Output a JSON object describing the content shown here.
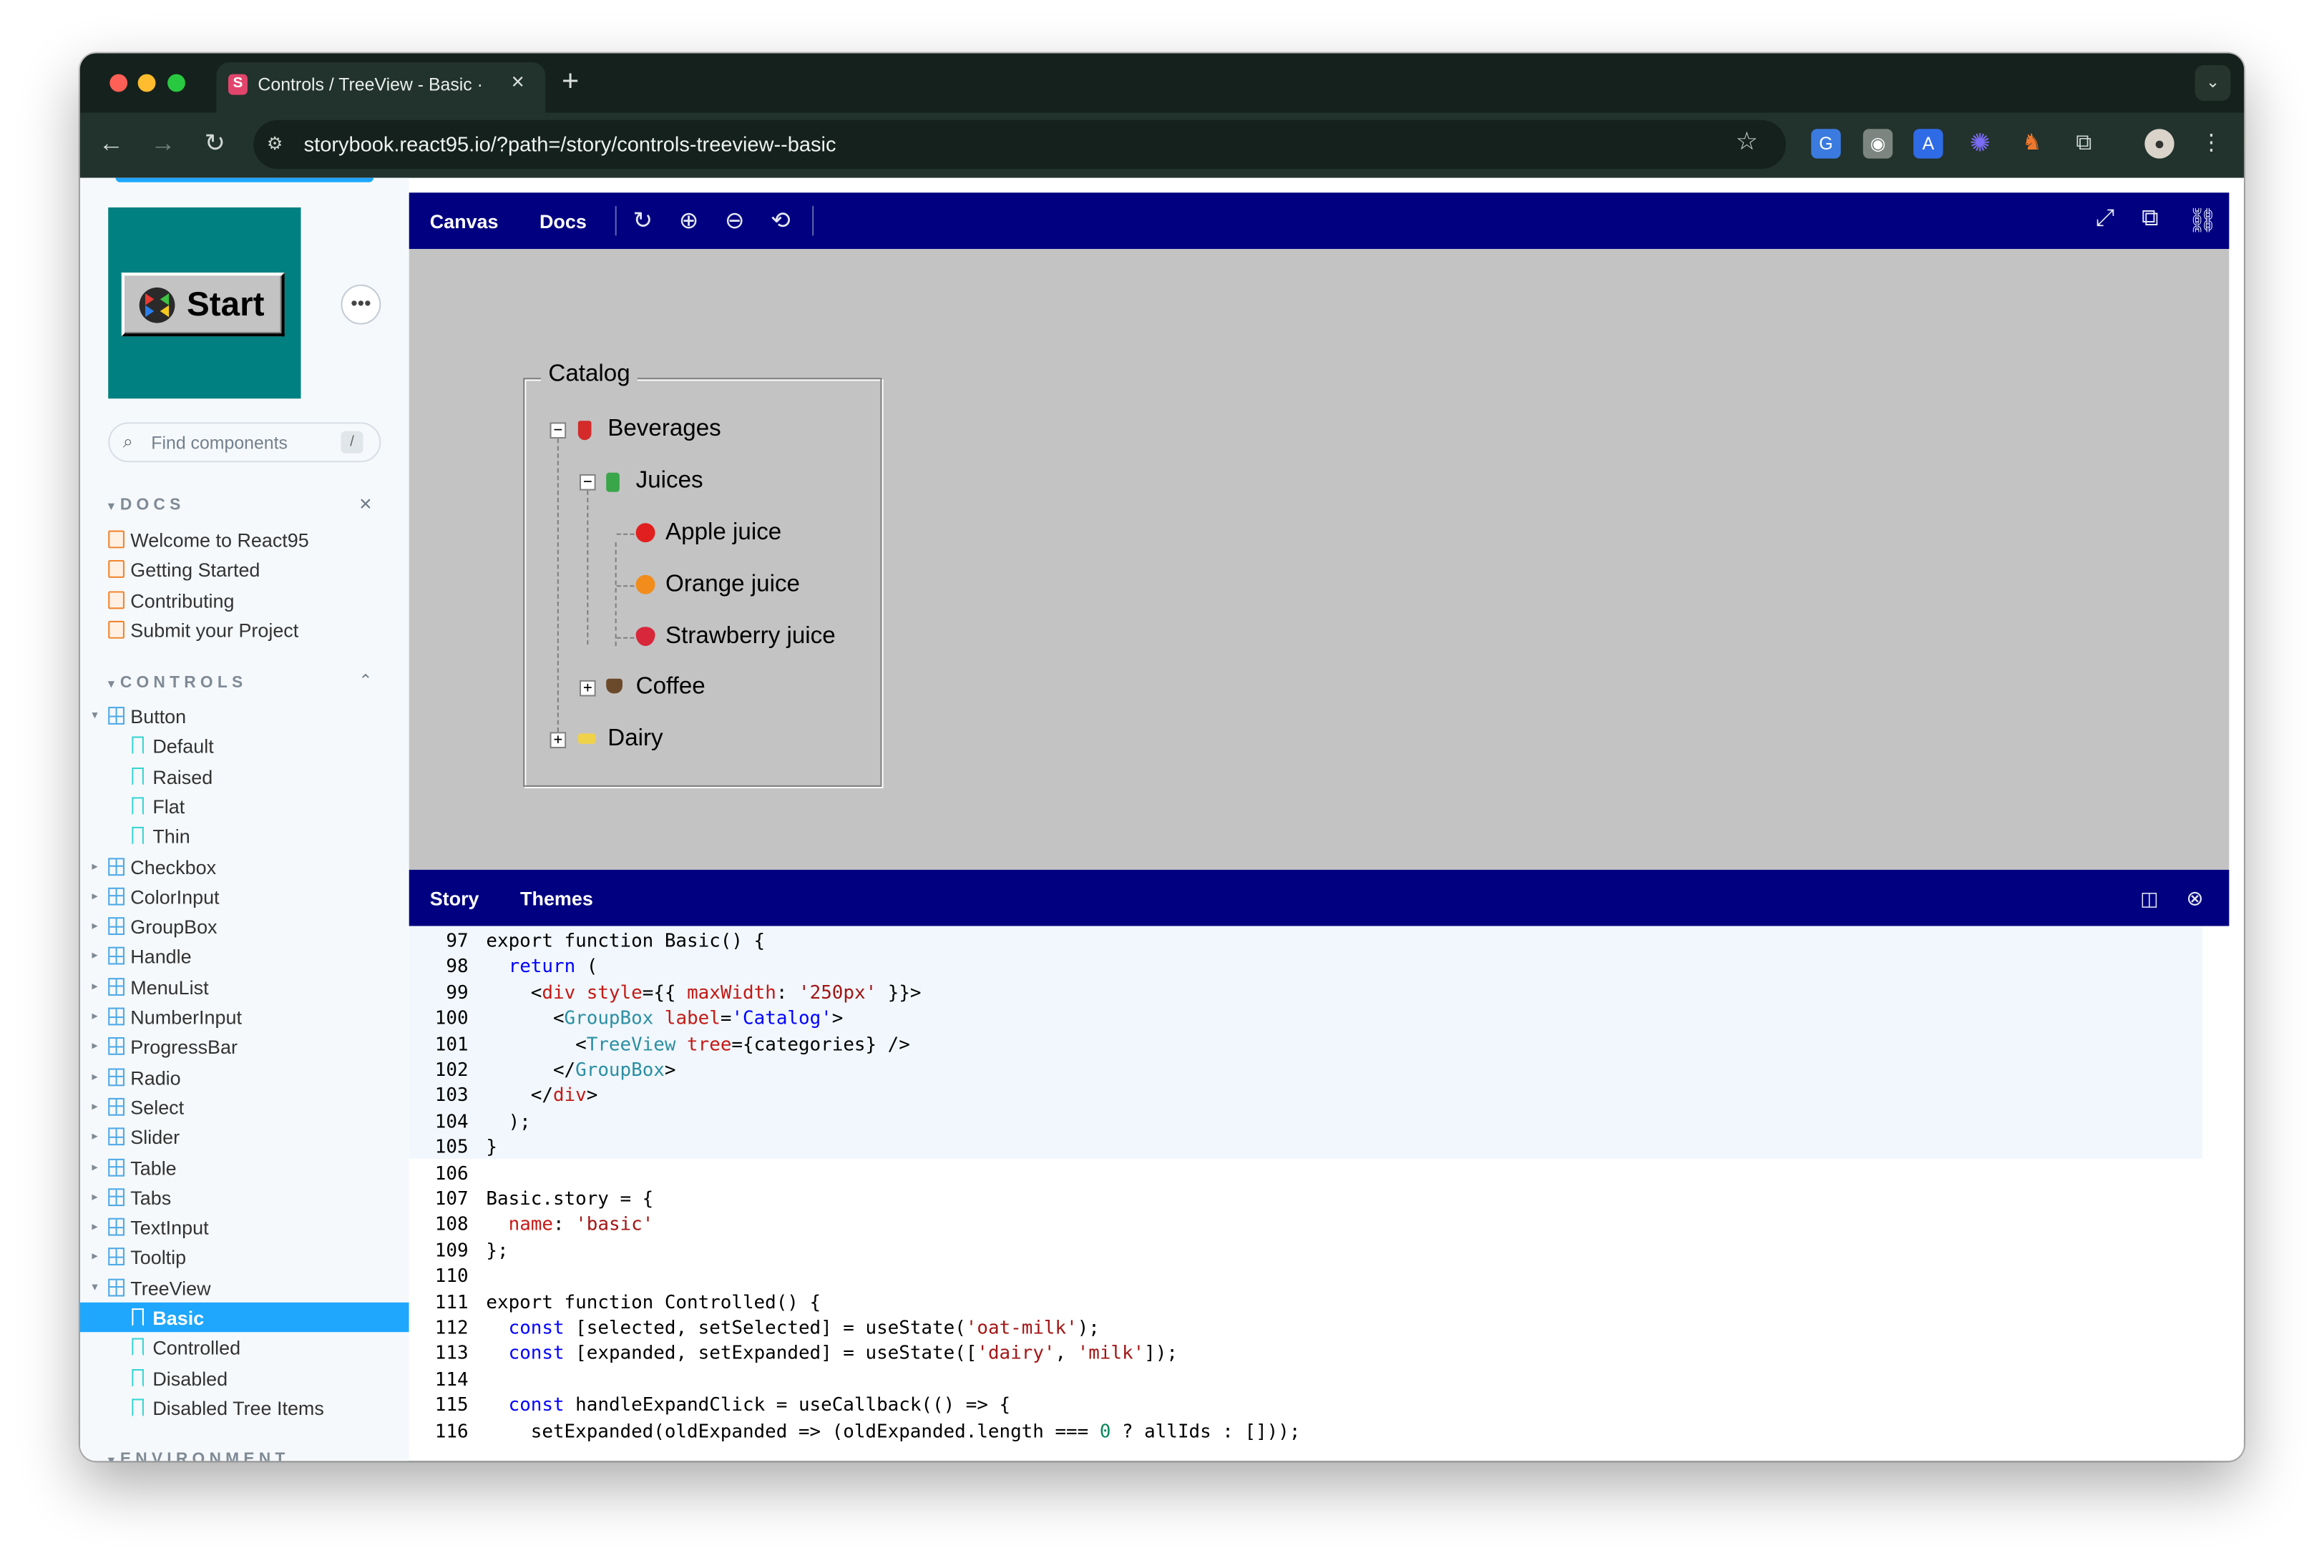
{
  "browser": {
    "tab_title": "Controls / TreeView - Basic ·",
    "tab_favicon": "S",
    "url": "storybook.react95.io/?path=/story/controls-treeview--basic",
    "colors": {
      "frame": "#15211c",
      "toolbar": "#22322c"
    }
  },
  "sidebar": {
    "logo_label": "Start",
    "search_placeholder": "Find components",
    "search_shortcut": "/",
    "docs_header": "DOCS",
    "docs": [
      "Welcome to React95",
      "Getting Started",
      "Contributing",
      "Submit your Project"
    ],
    "controls_header": "CONTROLS",
    "controls": [
      {
        "label": "Button",
        "expanded": true
      },
      {
        "label": "Default",
        "story": true
      },
      {
        "label": "Raised",
        "story": true
      },
      {
        "label": "Flat",
        "story": true
      },
      {
        "label": "Thin",
        "story": true
      },
      {
        "label": "Checkbox"
      },
      {
        "label": "ColorInput"
      },
      {
        "label": "GroupBox"
      },
      {
        "label": "Handle"
      },
      {
        "label": "MenuList"
      },
      {
        "label": "NumberInput"
      },
      {
        "label": "ProgressBar"
      },
      {
        "label": "Radio"
      },
      {
        "label": "Select"
      },
      {
        "label": "Slider"
      },
      {
        "label": "Table"
      },
      {
        "label": "Tabs"
      },
      {
        "label": "TextInput"
      },
      {
        "label": "Tooltip"
      },
      {
        "label": "TreeView",
        "expanded": true
      },
      {
        "label": "Basic",
        "story": true,
        "selected": true
      },
      {
        "label": "Controlled",
        "story": true
      },
      {
        "label": "Disabled",
        "story": true
      },
      {
        "label": "Disabled Tree Items",
        "story": true
      }
    ],
    "environment_header": "ENVIRONMENT",
    "selected_color": "#1ea7fd"
  },
  "toolbar": {
    "canvas_tab": "Canvas",
    "docs_tab": "Docs",
    "bar_color": "#000080"
  },
  "preview": {
    "groupbox_label": "Catalog",
    "tree": {
      "beverages": "Beverages",
      "juices": "Juices",
      "apple": "Apple juice",
      "orange": "Orange juice",
      "strawberry": "Strawberry juice",
      "coffee": "Coffee",
      "dairy": "Dairy"
    },
    "canvas_color": "#c3c3c3"
  },
  "addons": {
    "story_tab": "Story",
    "themes_tab": "Themes"
  },
  "code": {
    "lines": [
      {
        "n": "97",
        "hl": true,
        "html": "export function Basic() {"
      },
      {
        "n": "98",
        "hl": true,
        "html": "  <span class='k'>return</span> ("
      },
      {
        "n": "99",
        "hl": true,
        "html": "    &lt;<span class='a'>div</span> <span class='a'>style</span>={{ <span class='a'>maxWidth</span>: <span class='s'>'250px'</span> }}&gt;"
      },
      {
        "n": "100",
        "hl": true,
        "html": "      &lt;<span class='t'>GroupBox</span> <span class='a'>label</span>=<span class='k'>'Catalog'</span>&gt;"
      },
      {
        "n": "101",
        "hl": true,
        "html": "        &lt;<span class='t'>TreeView</span> <span class='a'>tree</span>={categories} /&gt;"
      },
      {
        "n": "102",
        "hl": true,
        "html": "      &lt;/<span class='t'>GroupBox</span>&gt;"
      },
      {
        "n": "103",
        "hl": true,
        "html": "    &lt;/<span class='a'>div</span>&gt;"
      },
      {
        "n": "104",
        "hl": true,
        "html": "  );"
      },
      {
        "n": "105",
        "hl": true,
        "html": "}"
      },
      {
        "n": "106",
        "hl": false,
        "html": ""
      },
      {
        "n": "107",
        "hl": false,
        "html": "Basic.story = {"
      },
      {
        "n": "108",
        "hl": false,
        "html": "  <span class='a'>name</span>: <span class='s'>'basic'</span>"
      },
      {
        "n": "109",
        "hl": false,
        "html": "};"
      },
      {
        "n": "110",
        "hl": false,
        "html": ""
      },
      {
        "n": "111",
        "hl": false,
        "html": "export function Controlled() {"
      },
      {
        "n": "112",
        "hl": false,
        "html": "  <span class='k'>const</span> [selected, setSelected] = useState(<span class='s'>'oat-milk'</span>);"
      },
      {
        "n": "113",
        "hl": false,
        "html": "  <span class='k'>const</span> [expanded, setExpanded] = useState([<span class='s'>'dairy'</span>, <span class='s'>'milk'</span>]);"
      },
      {
        "n": "114",
        "hl": false,
        "html": ""
      },
      {
        "n": "115",
        "hl": false,
        "html": "  <span class='k'>const</span> handleExpandClick = useCallback(() =&gt; {"
      },
      {
        "n": "116",
        "hl": false,
        "html": "    setExpanded(oldExpanded =&gt; (oldExpanded.length === <span class='n'>0</span> ? allIds : []));"
      }
    ]
  }
}
